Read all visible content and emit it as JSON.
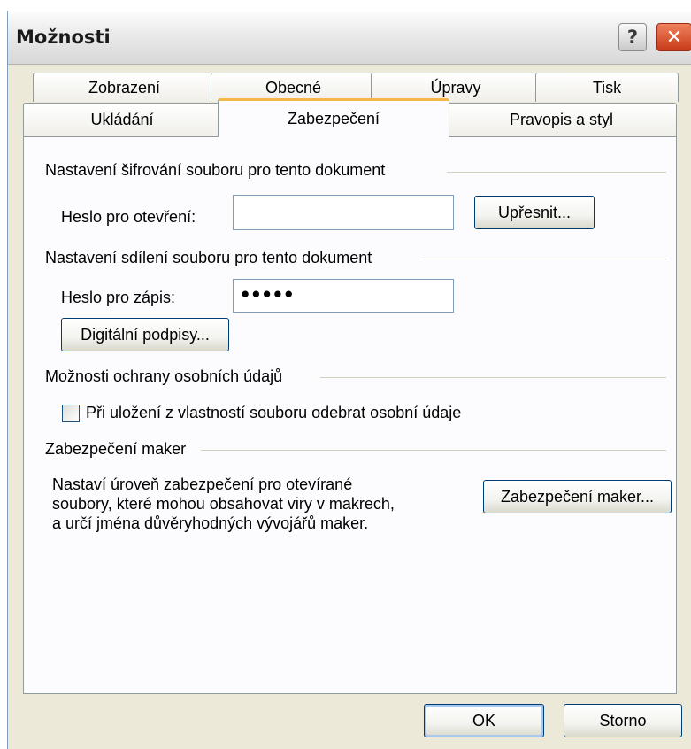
{
  "window": {
    "title": "Možnosti",
    "help_glyph": "?",
    "close_glyph": "✕"
  },
  "tabs_row1": [
    "Zobrazení",
    "Obecné",
    "Úpravy",
    "Tisk"
  ],
  "tabs_row2": [
    "Ukládání",
    "Zabezpečení",
    "Pravopis a styl"
  ],
  "active_tab": "Zabezpečení",
  "file_encryption": {
    "heading": "Nastavení šifrování souboru pro tento dokument",
    "open_password_label": "Heslo pro otevření:",
    "open_password_value": "",
    "advanced_button": "Upřesnit..."
  },
  "file_sharing": {
    "heading": "Nastavení sdílení souboru pro tento dokument",
    "write_password_label": "Heslo pro zápis:",
    "write_password_value": "●●●●●",
    "digital_signatures_button": "Digitální podpisy..."
  },
  "privacy": {
    "heading": "Možnosti ochrany osobních údajů",
    "remove_personal_info_label": "Při uložení z vlastností souboru odebrat osobní údaje",
    "remove_personal_info_checked": false
  },
  "macro_security": {
    "heading": "Zabezpečení maker",
    "description_lines": [
      "Nastaví úroveň zabezpečení pro otevírané",
      "soubory, které mohou obsahovat viry v makrech,",
      "a určí jména důvěryhodných vývojářů maker."
    ],
    "button": "Zabezpečení maker..."
  },
  "footer": {
    "ok": "OK",
    "cancel": "Storno"
  }
}
